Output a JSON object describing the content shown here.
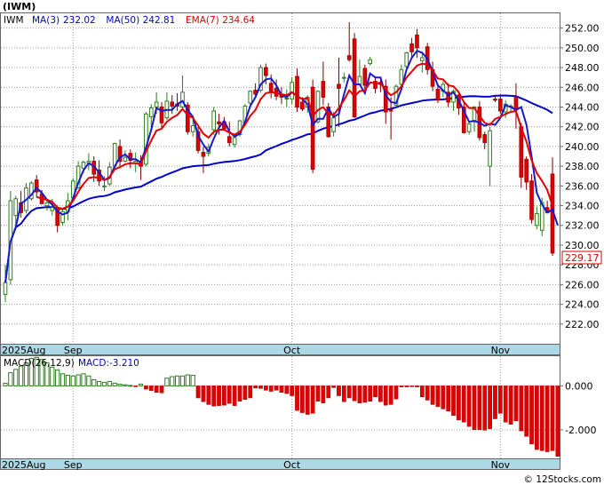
{
  "chart_data": {
    "type": "candlestick",
    "title": "(IWM)",
    "ticker": "IWM",
    "legend": [
      {
        "label": "MA(3)",
        "value": "232.02",
        "color": "#0000cc"
      },
      {
        "label": "MA(50)",
        "value": "242.81",
        "color": "#0000cc"
      },
      {
        "label": "EMA(7)",
        "value": "234.64",
        "color": "#e00000"
      }
    ],
    "last_price_label": "229.17",
    "ylim": [
      220,
      253.5
    ],
    "y_ticks": [
      "222.00",
      "224.00",
      "226.00",
      "228.00",
      "230.00",
      "232.00",
      "234.00",
      "236.00",
      "238.00",
      "240.00",
      "242.00",
      "244.00",
      "246.00",
      "248.00",
      "250.00",
      "252.00"
    ],
    "x_ticks": [
      {
        "label": "2025Aug",
        "index": 0
      },
      {
        "label": "Sep",
        "index": 13
      },
      {
        "label": "Oct",
        "index": 55
      },
      {
        "label": "Nov",
        "index": 95
      }
    ],
    "candles": [
      [
        225.0,
        228.0,
        224.2,
        226.2
      ],
      [
        226.5,
        235.5,
        226.0,
        234.5
      ],
      [
        233.0,
        235.0,
        232.0,
        234.7
      ],
      [
        234.3,
        235.5,
        232.8,
        233.3
      ],
      [
        233.5,
        236.3,
        233.2,
        235.8
      ],
      [
        234.7,
        236.5,
        234.5,
        236.3
      ],
      [
        236.6,
        237.1,
        234.8,
        235.4
      ],
      [
        235.2,
        235.6,
        234.2,
        234.2
      ],
      [
        234.0,
        234.5,
        233.5,
        234.3
      ],
      [
        233.5,
        234.7,
        233.0,
        233.8
      ],
      [
        233.7,
        234.0,
        231.3,
        232.0
      ],
      [
        232.3,
        233.6,
        232.0,
        233.4
      ],
      [
        233.4,
        235.3,
        232.5,
        234.5
      ],
      [
        234.8,
        236.8,
        234.4,
        236.5
      ],
      [
        235.8,
        238.5,
        235.7,
        238.0
      ],
      [
        237.8,
        238.6,
        237.3,
        238.4
      ],
      [
        238.3,
        239.3,
        237.6,
        238.5
      ],
      [
        238.5,
        239.0,
        236.4,
        237.2
      ],
      [
        237.6,
        238.6,
        236.0,
        236.5
      ],
      [
        236.0,
        237.0,
        235.5,
        236.0
      ],
      [
        236.2,
        238.4,
        236.0,
        237.9
      ],
      [
        238.0,
        240.4,
        237.6,
        240.3
      ],
      [
        240.0,
        240.7,
        238.0,
        238.5
      ],
      [
        238.5,
        239.6,
        238.4,
        238.9
      ],
      [
        239.3,
        239.7,
        237.8,
        238.6
      ],
      [
        238.3,
        239.4,
        237.4,
        238.5
      ],
      [
        238.4,
        239.1,
        236.6,
        238.0
      ],
      [
        238.2,
        243.5,
        238.0,
        243.3
      ],
      [
        243.0,
        244.3,
        242.0,
        243.9
      ],
      [
        244.0,
        245.5,
        243.3,
        244.5
      ],
      [
        244.0,
        244.5,
        241.8,
        242.4
      ],
      [
        242.9,
        245.5,
        242.7,
        244.6
      ],
      [
        244.5,
        245.2,
        243.3,
        244.1
      ],
      [
        244.3,
        245.4,
        243.6,
        244.1
      ],
      [
        244.0,
        247.2,
        243.9,
        245.5
      ],
      [
        244.2,
        244.5,
        241.2,
        241.5
      ],
      [
        241.5,
        243.0,
        241.0,
        242.1
      ],
      [
        241.5,
        242.0,
        239.3,
        239.6
      ],
      [
        239.4,
        240.0,
        237.3,
        239.0
      ],
      [
        239.3,
        240.3,
        239.0,
        239.9
      ],
      [
        241.7,
        244.0,
        241.2,
        243.6
      ],
      [
        242.5,
        243.3,
        241.2,
        242.3
      ],
      [
        242.5,
        243.0,
        241.8,
        241.8
      ],
      [
        241.0,
        242.5,
        240.0,
        240.4
      ],
      [
        240.2,
        241.2,
        239.9,
        240.9
      ],
      [
        241.2,
        242.7,
        241.0,
        242.6
      ],
      [
        242.4,
        244.3,
        242.2,
        244.1
      ],
      [
        244.4,
        245.7,
        244.0,
        245.6
      ],
      [
        245.7,
        246.4,
        245.0,
        245.3
      ],
      [
        245.7,
        248.3,
        245.5,
        248.0
      ],
      [
        248.0,
        248.4,
        246.3,
        247.2
      ],
      [
        246.4,
        247.3,
        244.9,
        245.5
      ],
      [
        245.9,
        246.8,
        244.7,
        245.1
      ],
      [
        245.3,
        246.0,
        244.3,
        245.0
      ],
      [
        244.9,
        245.8,
        244.0,
        244.9
      ],
      [
        244.8,
        247.0,
        244.3,
        246.5
      ],
      [
        247.1,
        247.9,
        243.5,
        244.0
      ],
      [
        244.5,
        245.0,
        243.6,
        243.8
      ],
      [
        244.0,
        245.2,
        243.4,
        245.0
      ],
      [
        246.0,
        246.8,
        237.3,
        237.7
      ],
      [
        242.5,
        245.7,
        242.3,
        245.6
      ],
      [
        246.6,
        248.6,
        244.2,
        245.0
      ],
      [
        244.0,
        244.4,
        240.9,
        241.0
      ],
      [
        241.5,
        243.5,
        241.0,
        242.9
      ],
      [
        246.3,
        249.0,
        242.0,
        245.9
      ],
      [
        247.0,
        247.5,
        246.5,
        247.0
      ],
      [
        249.2,
        252.6,
        248.6,
        248.8
      ],
      [
        250.9,
        251.5,
        242.9,
        243.0
      ],
      [
        246.3,
        248.8,
        246.2,
        247.1
      ],
      [
        247.9,
        248.3,
        245.6,
        246.2
      ],
      [
        248.4,
        249.1,
        248.2,
        248.8
      ],
      [
        246.6,
        247.1,
        245.4,
        245.9
      ],
      [
        246.5,
        247.0,
        245.5,
        246.3
      ],
      [
        246.1,
        246.8,
        242.3,
        243.5
      ],
      [
        243.7,
        245.0,
        240.7,
        243.6
      ],
      [
        244.2,
        246.3,
        244.0,
        246.1
      ],
      [
        246.3,
        248.3,
        246.2,
        247.8
      ],
      [
        248.1,
        249.6,
        247.9,
        249.5
      ],
      [
        250.4,
        251.0,
        249.0,
        249.6
      ],
      [
        251.3,
        251.9,
        249.0,
        250.0
      ],
      [
        248.7,
        249.6,
        247.5,
        249.0
      ],
      [
        250.1,
        250.5,
        247.3,
        247.8
      ],
      [
        247.8,
        248.6,
        245.6,
        246.1
      ],
      [
        245.8,
        246.4,
        244.4,
        244.7
      ],
      [
        245.6,
        246.6,
        245.0,
        246.3
      ],
      [
        245.5,
        246.4,
        244.0,
        244.5
      ],
      [
        244.5,
        245.8,
        243.6,
        245.6
      ],
      [
        245.2,
        245.6,
        243.2,
        243.9
      ],
      [
        244.0,
        244.6,
        241.3,
        241.4
      ],
      [
        241.5,
        242.5,
        241.2,
        242.3
      ],
      [
        242.5,
        244.1,
        241.5,
        244.0
      ],
      [
        244.0,
        244.6,
        240.6,
        240.9
      ],
      [
        241.2,
        241.5,
        239.7,
        240.4
      ],
      [
        238.0,
        242.0,
        236.0,
        241.6
      ],
      [
        244.8,
        245.2,
        244.5,
        244.7
      ],
      [
        244.8,
        245.3,
        243.3,
        243.6
      ],
      [
        243.5,
        244.7,
        242.9,
        244.3
      ],
      [
        244.0,
        244.3,
        243.5,
        244.1
      ],
      [
        245.0,
        246.4,
        241.8,
        243.7
      ],
      [
        242.0,
        242.4,
        235.8,
        236.9
      ],
      [
        238.7,
        239.0,
        235.6,
        236.4
      ],
      [
        236.5,
        237.2,
        232.2,
        232.6
      ],
      [
        232.0,
        233.9,
        231.6,
        233.2
      ],
      [
        231.5,
        234.8,
        230.9,
        234.3
      ],
      [
        233.8,
        234.5,
        233.2,
        233.3
      ],
      [
        237.2,
        238.9,
        228.9,
        229.2
      ]
    ],
    "ma3": [
      226.2,
      230.4,
      231.8,
      234.2,
      234.6,
      235.1,
      235.8,
      235.3,
      234.6,
      234.1,
      233.4,
      233.1,
      233.3,
      234.8,
      236.3,
      237.6,
      238.3,
      238.0,
      237.4,
      236.6,
      236.8,
      238.0,
      238.9,
      239.2,
      238.7,
      238.7,
      238.4,
      239.9,
      241.7,
      243.9,
      243.6,
      243.7,
      243.7,
      244.3,
      244.6,
      243.7,
      243.0,
      241.1,
      240.2,
      239.5,
      240.8,
      241.9,
      242.6,
      241.5,
      241.0,
      241.3,
      242.5,
      244.1,
      245.0,
      246.3,
      246.8,
      246.9,
      246.2,
      245.2,
      245.0,
      245.5,
      245.1,
      244.8,
      244.3,
      242.2,
      242.8,
      242.8,
      243.9,
      243.0,
      243.3,
      245.3,
      247.2,
      246.3,
      246.3,
      245.4,
      247.4,
      247.0,
      247.0,
      245.2,
      244.5,
      244.4,
      245.8,
      247.8,
      249.0,
      249.7,
      249.5,
      248.9,
      247.6,
      246.2,
      245.7,
      245.2,
      245.5,
      244.7,
      243.6,
      242.5,
      242.6,
      242.4,
      242.1,
      242.3,
      242.2,
      242.9,
      244.2,
      244.0,
      243.7,
      244.0,
      242.2,
      239.0,
      235.3,
      234.1,
      233.3,
      233.6,
      232.0
    ],
    "ema7": [
      null,
      null,
      null,
      null,
      null,
      null,
      234.9,
      234.7,
      234.6,
      234.4,
      233.8,
      233.7,
      233.9,
      234.5,
      235.4,
      236.2,
      236.8,
      236.9,
      236.8,
      236.6,
      236.9,
      237.7,
      237.9,
      238.2,
      238.3,
      238.3,
      238.2,
      239.5,
      240.6,
      241.6,
      241.8,
      242.5,
      242.9,
      243.2,
      243.8,
      243.2,
      242.9,
      242.1,
      241.3,
      240.9,
      241.5,
      241.7,
      241.7,
      241.4,
      241.2,
      241.5,
      242.2,
      243.1,
      243.7,
      244.8,
      245.4,
      245.5,
      245.4,
      245.3,
      245.2,
      245.5,
      245.1,
      244.8,
      244.9,
      243.1,
      243.7,
      244.0,
      243.3,
      243.2,
      243.9,
      244.7,
      245.7,
      245.1,
      245.6,
      245.7,
      246.5,
      246.4,
      246.4,
      245.7,
      245.2,
      245.5,
      246.1,
      247.0,
      247.6,
      248.2,
      248.4,
      248.3,
      247.7,
      246.9,
      246.8,
      246.2,
      246.1,
      245.5,
      244.5,
      243.9,
      243.9,
      243.1,
      242.4,
      242.2,
      242.8,
      243.0,
      243.3,
      243.5,
      243.6,
      241.9,
      240.5,
      238.6,
      237.3,
      236.5,
      235.6,
      234.0
    ]
  },
  "macd": {
    "label": "MACD(26,12,9)",
    "value_label": "MACD:-3.210",
    "ylim": [
      -3.3,
      1.35
    ],
    "y_ticks": [
      "0.000",
      "-2.000"
    ],
    "histogram": [
      0.12,
      0.6,
      0.75,
      0.9,
      1.05,
      1.25,
      1.3,
      1.2,
      1.05,
      0.85,
      0.72,
      0.55,
      0.48,
      0.45,
      0.5,
      0.55,
      0.45,
      0.28,
      0.2,
      0.16,
      0.2,
      0.12,
      0.08,
      0.05,
      0.02,
      -0.02,
      0.08,
      -0.15,
      -0.22,
      -0.3,
      -0.32,
      0.35,
      0.42,
      0.45,
      0.45,
      0.5,
      0.48,
      -0.55,
      -0.72,
      -0.85,
      -0.92,
      -0.9,
      -0.88,
      -0.8,
      -0.9,
      -0.7,
      -0.62,
      -0.55,
      -0.1,
      -0.12,
      -0.2,
      -0.25,
      -0.2,
      -0.3,
      -0.35,
      -0.45,
      -1.12,
      -1.22,
      -1.3,
      -1.25,
      -0.7,
      -0.78,
      -0.55,
      -0.08,
      -0.45,
      -0.72,
      -0.55,
      -0.68,
      -0.78,
      -0.75,
      -0.7,
      -0.5,
      -0.72,
      -0.88,
      -0.85,
      -0.6,
      -0.05,
      -0.05,
      -0.04,
      -0.05,
      -0.5,
      -0.65,
      -0.85,
      -0.95,
      -1.05,
      -1.15,
      -1.35,
      -1.55,
      -1.65,
      -1.85,
      -2.0,
      -2.0,
      -2.02,
      -1.95,
      -1.5,
      -1.25,
      -1.65,
      -1.75,
      -1.6,
      -2.05,
      -2.3,
      -2.65,
      -2.9,
      -2.95,
      -3.0,
      -2.95,
      -3.21
    ]
  },
  "watermark": "© 12Stocks.com"
}
